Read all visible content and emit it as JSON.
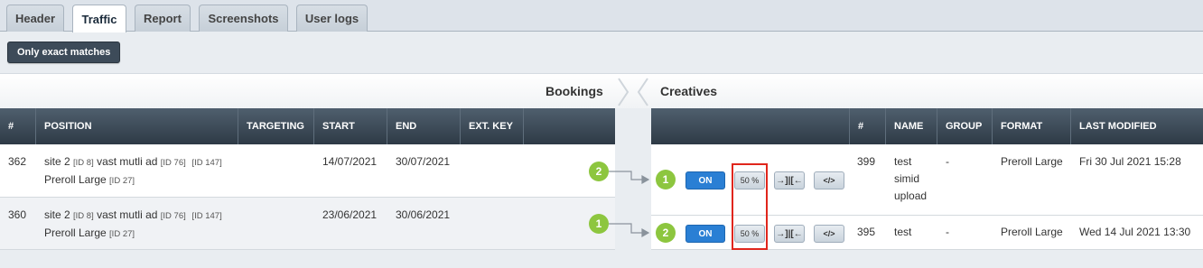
{
  "tabs": [
    {
      "label": "Header"
    },
    {
      "label": "Traffic"
    },
    {
      "label": "Report"
    },
    {
      "label": "Screenshots"
    },
    {
      "label": "User logs"
    }
  ],
  "filter": {
    "exact_label": "Only exact matches"
  },
  "sections": {
    "bookings": "Bookings",
    "creatives": "Creatives"
  },
  "bookings": {
    "headers": [
      "#",
      "POSITION",
      "TARGETING",
      "START",
      "END",
      "EXT. KEY"
    ],
    "rows": [
      {
        "id": "362",
        "site": "site 2",
        "site_id": "[ID 8]",
        "ad": "vast mutli ad",
        "ad_id": "[ID 76]",
        "extra_id": "[ID 147]",
        "format": "Preroll Large",
        "format_id": "[ID 27]",
        "start": "14/07/2021",
        "end": "30/07/2021",
        "count": "2"
      },
      {
        "id": "360",
        "site": "site 2",
        "site_id": "[ID 8]",
        "ad": "vast mutli ad",
        "ad_id": "[ID 76]",
        "extra_id": "[ID 147]",
        "format": "Preroll Large",
        "format_id": "[ID 27]",
        "start": "23/06/2021",
        "end": "30/06/2021",
        "count": "1"
      }
    ]
  },
  "creatives": {
    "headers": [
      "#",
      "NAME",
      "GROUP",
      "FORMAT",
      "LAST MODIFIED"
    ],
    "rows": [
      {
        "badge": "1",
        "on_label": "ON",
        "pct_label": "50 %",
        "swap_icon": "→]|[←",
        "code_icon": "</>",
        "id": "399",
        "name_lines": [
          "test",
          "simid",
          "upload"
        ],
        "group": "-",
        "format": "Preroll Large",
        "modified": "Fri 30 Jul 2021 15:28"
      },
      {
        "badge": "2",
        "on_label": "ON",
        "pct_label": "50 %",
        "swap_icon": "→]|[←",
        "code_icon": "</>",
        "id": "395",
        "name_lines": [
          "test"
        ],
        "group": "-",
        "format": "Preroll Large",
        "modified": "Wed 14 Jul 2021 13:30"
      }
    ]
  },
  "colors": {
    "accent_on": "#2a7fd4",
    "badge": "#8dc63f",
    "highlight": "#e0261c",
    "header_bg": "#2e3a46"
  }
}
